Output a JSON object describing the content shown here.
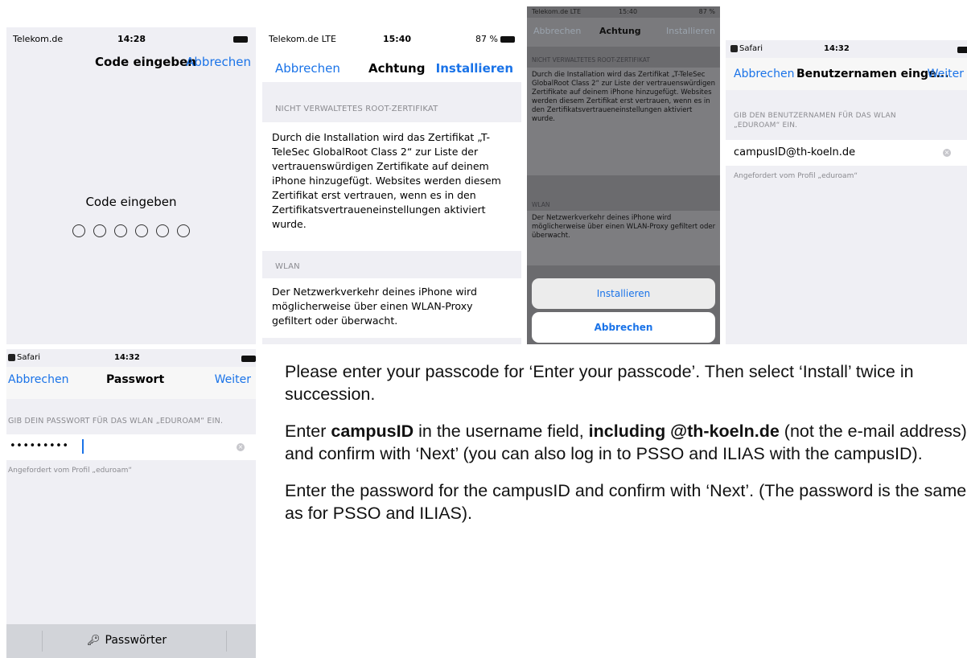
{
  "screen1": {
    "carrier": "Telekom.de",
    "time": "14:28",
    "title": "Code eingeben",
    "cancel": "Abbrechen",
    "prompt": "Code eingeben"
  },
  "screen2": {
    "carrier": "Telekom.de  LTE",
    "time": "15:40",
    "battery": "87 %",
    "cancel": "Abbrechen",
    "title": "Achtung",
    "install": "Installieren",
    "section1": "NICHT VERWALTETES ROOT-ZERTIFIKAT",
    "body1": "Durch die Installation wird das Zertifikat „T-TeleSec GlobalRoot Class 2“ zur Liste der vertrauenswürdigen Zertifikate auf deinem iPhone hinzugefügt. Websites werden diesem Zertifikat erst vertrauen, wenn es in den Zertifikatsvertraueneinstellungen aktiviert wurde.",
    "section2": "WLAN",
    "body2": "Der Netzwerkverkehr deines iPhone wird möglicherweise über einen WLAN-Proxy gefiltert oder überwacht."
  },
  "screen3": {
    "carrier": "Telekom.de  LTE",
    "time": "15:40",
    "battery": "87 %",
    "cancel": "Abbrechen",
    "title": "Achtung",
    "install": "Installieren",
    "section1": "NICHT VERWALTETES ROOT-ZERTIFIKAT",
    "body1": "Durch die Installation wird das Zertifikat „T-TeleSec GlobalRoot Class 2“ zur Liste der vertrauenswürdigen Zertifikate auf deinem iPhone hinzugefügt. Websites werden diesem Zertifikat erst vertrauen, wenn es in den Zertifikatsvertraueneinstellungen aktiviert wurde.",
    "section2": "WLAN",
    "body2": "Der Netzwerkverkehr deines iPhone wird möglicherweise über einen WLAN-Proxy gefiltert oder überwacht.",
    "sheet_install": "Installieren",
    "sheet_cancel": "Abbrechen"
  },
  "screen4": {
    "app": "Safari",
    "time": "14:32",
    "cancel": "Abbrechen",
    "title": "Benutzernamen einge...",
    "next": "Weiter",
    "section": "GIB DEN BENUTZERNAMEN FÜR DAS WLAN „EDUROAM“ EIN.",
    "username": "campusID@th-koeln.de",
    "footer": "Angefordert vom Profil „eduroam“"
  },
  "screen5": {
    "app": "Safari",
    "time": "14:32",
    "cancel": "Abbrechen",
    "title": "Passwort",
    "next": "Weiter",
    "section": "GIB DEIN PASSWORT FÜR DAS WLAN „EDUROAM“ EIN.",
    "password_mask": "•••••••••",
    "footer": "Angefordert vom Profil „eduroam“",
    "keyboard_bar": "Passwörter"
  },
  "instructions": {
    "p1": "Please enter your passcode for ‘Enter your passcode’. Then select ‘Install’ twice in succession.",
    "p2_a": "Enter ",
    "p2_b": "campusID",
    "p2_c": " in the username field, ",
    "p2_d": "including @th-koeln.de",
    "p2_e": " (not the e-mail address) and confirm with ‘Next’ (you can also log in to PSSO and ILIAS with the campusID).",
    "p3": "Enter the password for the campusID and confirm with ‘Next’. (The password is the same as for PSSO and ILIAS)."
  }
}
